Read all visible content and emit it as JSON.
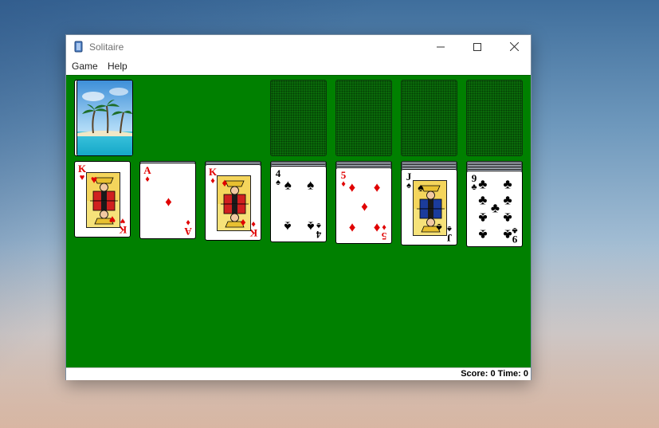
{
  "window": {
    "title": "Solitaire",
    "app_icon": "cards-icon",
    "controls": {
      "minimize": "minimize-icon",
      "maximize": "maximize-icon",
      "close": "close-icon"
    }
  },
  "menu": {
    "items": [
      "Game",
      "Help"
    ]
  },
  "game": {
    "table_color": "#008000",
    "stock": {
      "card_back": "beach-palm-trees",
      "face_down": true
    },
    "foundations": [
      "",
      "",
      "",
      ""
    ],
    "tableau": [
      {
        "face_down": 0,
        "top": {
          "rank": "K",
          "suit": "♥",
          "color": "red"
        }
      },
      {
        "face_down": 1,
        "top": {
          "rank": "A",
          "suit": "♦",
          "color": "red"
        }
      },
      {
        "face_down": 2,
        "top": {
          "rank": "K",
          "suit": "♦",
          "color": "red"
        }
      },
      {
        "face_down": 3,
        "top": {
          "rank": "4",
          "suit": "♠",
          "color": "black"
        }
      },
      {
        "face_down": 4,
        "top": {
          "rank": "5",
          "suit": "♦",
          "color": "red"
        }
      },
      {
        "face_down": 5,
        "top": {
          "rank": "J",
          "suit": "♠",
          "color": "black"
        }
      },
      {
        "face_down": 6,
        "top": {
          "rank": "9",
          "suit": "♣",
          "color": "black"
        }
      }
    ]
  },
  "status": {
    "text": "Score: 0 Time: 0"
  },
  "colors": {
    "red_suit": "#e00000",
    "black_suit": "#000000",
    "card_back": "#8fa6c9"
  }
}
